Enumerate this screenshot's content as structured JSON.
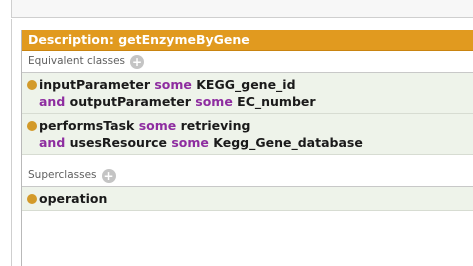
{
  "panel": {
    "header": "Description: getEnzymeByGene"
  },
  "equivalent_classes": {
    "label": "Equivalent classes",
    "add_symbol": "+",
    "axioms": [
      {
        "line1": {
          "prop": "inputParameter",
          "kw": "some",
          "cls": "KEGG_gene_id"
        },
        "line2": {
          "and": "and",
          "prop": "outputParameter",
          "kw": "some",
          "cls": "EC_number"
        }
      },
      {
        "line1": {
          "prop": "performsTask",
          "kw": "some",
          "cls": "retrieving"
        },
        "line2": {
          "and": "and",
          "prop": "usesResource",
          "kw": "some",
          "cls": "Kegg_Gene_database"
        }
      }
    ]
  },
  "superclasses": {
    "label": "Superclasses",
    "add_symbol": "+",
    "items": [
      "operation"
    ]
  },
  "colors": {
    "header": "#e19a1f",
    "keyword": "#8e2da0",
    "axiom_bg": "#eef3ea",
    "bullet": "#d39a2a"
  }
}
